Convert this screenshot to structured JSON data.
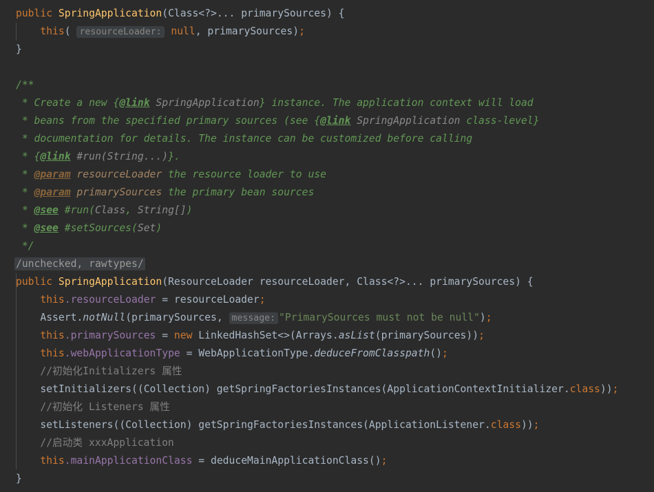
{
  "editor": {
    "language": "java",
    "theme": "darcula",
    "background": "#2b2b2b",
    "colors": {
      "keyword": "#cc7832",
      "declaration": "#ffc66d",
      "field": "#9876aa",
      "string": "#6a8759",
      "javadoc": "#629755",
      "javadoc_tag": "#8a653b",
      "line_comment": "#808080",
      "identifier": "#a9b7c6",
      "hint_badge_bg": "#3c3f41",
      "folded_bg": "#3b3f41"
    }
  },
  "code": {
    "l1": {
      "kw_public": "public",
      "decl": "SpringApplication",
      "sig": "(Class<?>... primarySources) {"
    },
    "l2": {
      "kw_this": "this",
      "open": "(",
      "hint": "resourceLoader:",
      "kw_null": " null",
      "rest": ", primarySources)",
      "semi": ";"
    },
    "l3": {
      "brace": "}"
    },
    "l5": {
      "doc": "/**"
    },
    "l6": {
      "pre": " * Create a new {",
      "tag": "@link",
      "target": " SpringApplication",
      "post": "} instance. The application context will load"
    },
    "l7": {
      "pre": " * beans from the specified primary sources (see {",
      "tag": "@link",
      "target": " SpringApplication",
      "post": " class-level}"
    },
    "l8": {
      "doc": " * documentation for details. The instance can be customized before calling"
    },
    "l9": {
      "pre": " * {",
      "tag": "@link",
      "target": " #run(String...)",
      "post": "}."
    },
    "l10": {
      "star": " * ",
      "tag": "@param",
      "name": " resourceLoader",
      "text": " the resource loader to use"
    },
    "l11": {
      "star": " * ",
      "tag": "@param",
      "name": " primarySources",
      "text": " the primary bean sources"
    },
    "l12": {
      "star": " * ",
      "tag": "@see",
      "ref": " #run(",
      "t1": "Class",
      "mid": ", ",
      "t2": "String[]",
      "end": ")"
    },
    "l13": {
      "star": " * ",
      "tag": "@see",
      "ref": " #setSources(",
      "t1": "Set",
      "end": ")"
    },
    "l14": {
      "doc": " */"
    },
    "l15": {
      "folded": "/unchecked, rawtypes/"
    },
    "l16": {
      "kw_public": "public",
      "decl": "SpringApplication",
      "open": "(",
      "t1": "ResourceLoader",
      "p1": " resourceLoader, ",
      "sig": "Class<?>... primarySources) {"
    },
    "l17": {
      "kw_this": "this",
      "dot": ".",
      "field": "resourceLoader",
      "eq": " = resourceLoader",
      "semi": ";"
    },
    "l18": {
      "cls": "Assert",
      "dot": ".",
      "mth": "notNull",
      "args": "(primarySources, ",
      "hint": "message:",
      "str": "\"PrimarySources must not be null\"",
      "close": ")",
      "semi": ";"
    },
    "l19": {
      "kw_this": "this",
      "dot": ".",
      "field": "primarySources",
      "eq": " = ",
      "kw_new": "new",
      "cls": " LinkedHashSet<>(Arrays.",
      "mth": "asList",
      "args": "(primarySources))",
      "semi": ";"
    },
    "l20": {
      "kw_this": "this",
      "dot": ".",
      "field": "webApplicationType",
      "eq": " = WebApplicationType.",
      "mth": "deduceFromClasspath",
      "args": "()",
      "semi": ";"
    },
    "l21": {
      "cmt": "//初始化Initializers 属性"
    },
    "l22": {
      "call": "setInitializers((Collection) getSpringFactoriesInstances(ApplicationContextInitializer.",
      "kw_class": "class",
      "close": "))",
      "semi": ";"
    },
    "l23": {
      "cmt": "//初始化 Listeners 属性"
    },
    "l24": {
      "call": "setListeners((Collection) getSpringFactoriesInstances(ApplicationListener.",
      "kw_class": "class",
      "close": "))",
      "semi": ";"
    },
    "l25": {
      "cmt": "//启动类 xxxApplication"
    },
    "l26": {
      "kw_this": "this",
      "dot": ".",
      "field": "mainApplicationClass",
      "eq": " = deduceMainApplicationClass()",
      "semi": ";"
    },
    "l27": {
      "brace": "}"
    }
  }
}
